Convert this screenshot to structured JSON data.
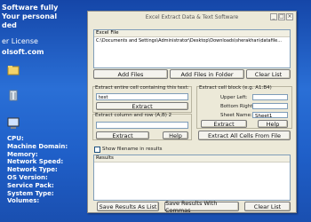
{
  "desktop": {
    "promo": {
      "line1": "Software fully",
      "line2": "Your personal",
      "line3": "ded",
      "line4": "er License",
      "line5": "olsoft.com"
    },
    "sysinfo": [
      "CPU:",
      "Machine Domain:",
      "Memory:",
      "Network Speed:",
      "Network Type:",
      "OS Version:",
      "Service Pack:",
      "System Type:",
      "Volumes:"
    ]
  },
  "window": {
    "title": "Excel Extract Data & Text Software",
    "files": {
      "header": "Excel File",
      "path": "C:\\Documents and Settings\\Administrator\\Desktop\\Downloads\\sherakhan\\datafile...",
      "add_files": "Add Files",
      "add_folder": "Add Files in Folder",
      "clear_list": "Clear List"
    },
    "extract_text": {
      "label": "Extract entire cell containing this text:",
      "value": "test",
      "extract": "Extract"
    },
    "extract_row": {
      "label": "Extract column and row (A,B) 2",
      "value": "",
      "extract": "Extract",
      "help": "Help"
    },
    "extract_block": {
      "label": "Extract cell block (e.g. A1:B4)",
      "upper_left_label": "Upper Left:",
      "upper_left_value": "",
      "bottom_right_label": "Bottom Right:",
      "bottom_right_value": "",
      "sheet_name_label": "Sheet Name:",
      "sheet_name_value": "Sheet1",
      "extract": "Extract",
      "help": "Help",
      "extract_all": "Extract All Cells From File"
    },
    "options": {
      "show_filename": "Show filename in results"
    },
    "results": {
      "header": "Results",
      "save_list": "Save Results As List",
      "save_commas": "Save Results With Commas",
      "clear_list": "Clear List"
    }
  }
}
